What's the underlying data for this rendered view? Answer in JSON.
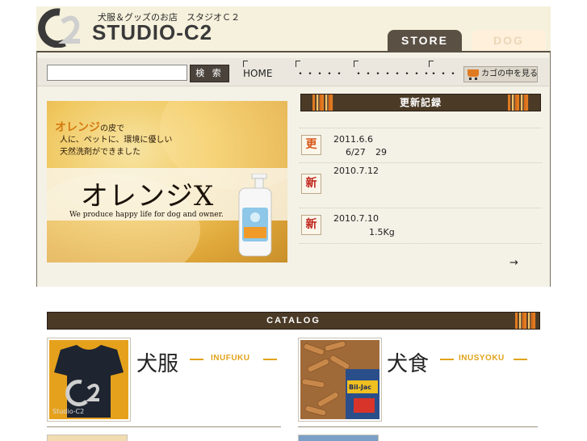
{
  "header": {
    "tagline": "犬服＆グッズのお店　スタジオＣ２",
    "brand": "STUDIO-C2",
    "tabs": [
      {
        "label": "STORE",
        "active": true
      },
      {
        "label": "DOG",
        "active": false
      }
    ]
  },
  "nav": {
    "search_placeholder": "",
    "search_button": "検 索",
    "links": [
      "HOME",
      "・・・・・",
      "・・・・・・・・",
      "・・・"
    ],
    "cart_label": "カゴの中を見る"
  },
  "banner": {
    "line1_highlight": "オレンジ",
    "line1_rest": "の皮で",
    "line2": "人に、ペットに、環境に優しい",
    "line3": "天然洗剤ができました",
    "product": "オレンジX",
    "tagline": "We produce happy life for dog and owner."
  },
  "updates": {
    "title": "更新記録",
    "entries": [
      {
        "badge": "更",
        "kind": "update",
        "date": "2011.6.6",
        "sub1": "6/27",
        "sub2": "29"
      },
      {
        "badge": "新",
        "kind": "new",
        "date": "2010.7.12"
      },
      {
        "badge": "新",
        "kind": "new",
        "date": "2010.7.10",
        "sub1": "1.5Kg"
      }
    ],
    "more": "→"
  },
  "catalog": {
    "title": "CATALOG",
    "items": [
      {
        "title": "犬服",
        "sub": "INUFUKU",
        "thumb_label": "Studio-C2"
      },
      {
        "title": "犬食",
        "sub": "INUSYOKU",
        "thumb_label": "Bil-Jac"
      }
    ]
  },
  "colors": {
    "dark_brown": "#5a5044",
    "accent_orange": "#e07a20",
    "catalog_sub": "#e0a31a",
    "panel_bg": "#f4f1e7"
  }
}
